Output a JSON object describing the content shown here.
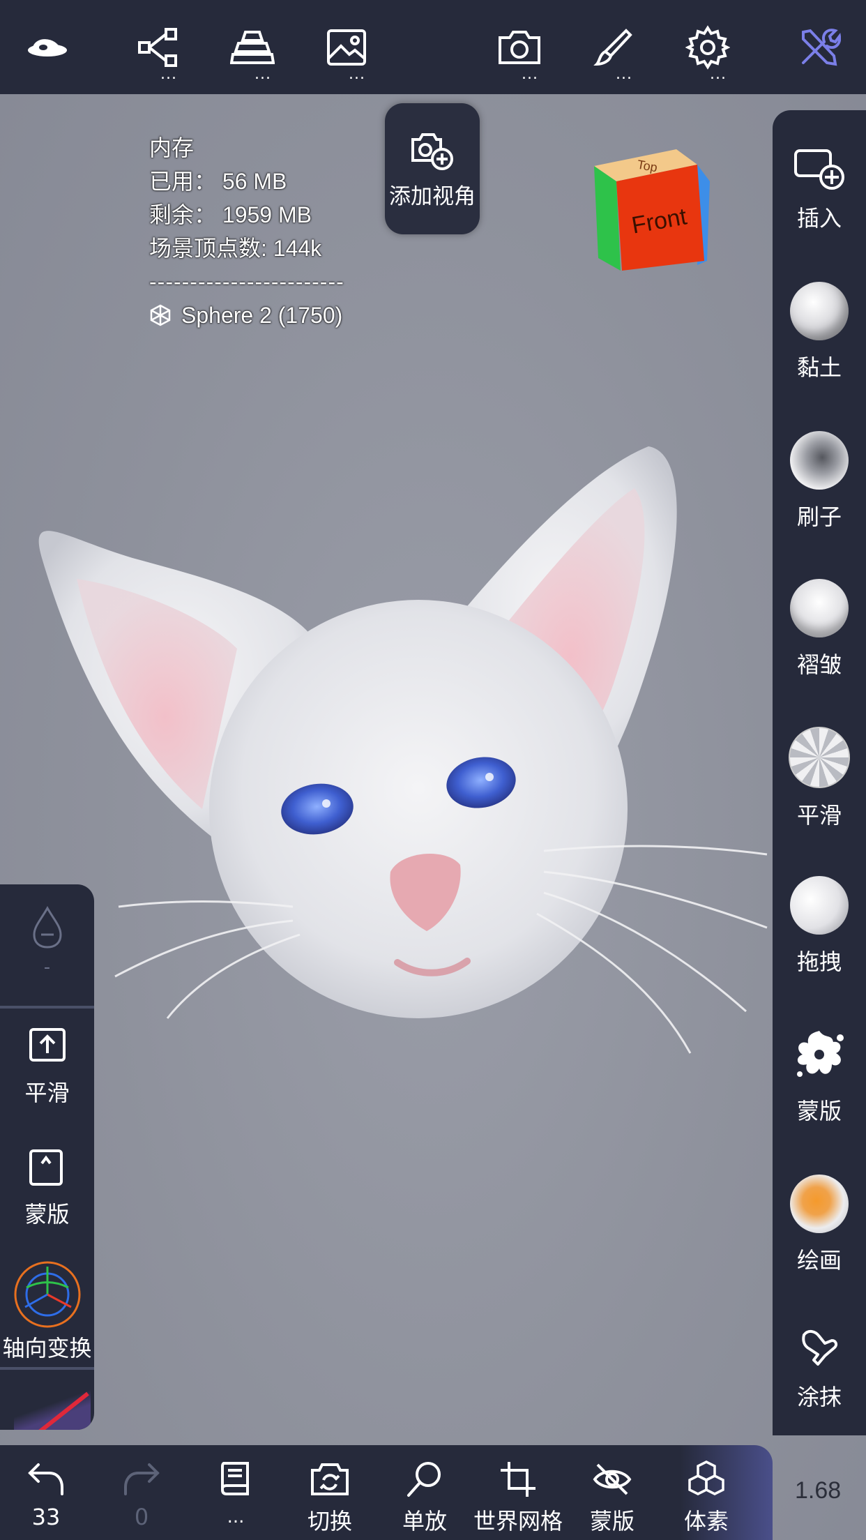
{
  "topbar": {
    "icons": [
      "sculpt-logo-icon",
      "scene-graph-icon",
      "material-stack-icon",
      "background-image-icon",
      "camera-icon",
      "brush-settings-icon",
      "settings-gear-icon",
      "tools-icon"
    ],
    "more_indicator": "..."
  },
  "info": {
    "memory_title": "内存",
    "used": "已用：  56 MB",
    "free": "剩余：  1959 MB",
    "vertices": "场景顶点数: 144k",
    "separator": "------------------------",
    "object": "Sphere 2 (1750)"
  },
  "add_view": {
    "label": "添加视角"
  },
  "view_cube": {
    "front": "Front",
    "top": "Top"
  },
  "right_tools": [
    {
      "label": "插入"
    },
    {
      "label": "黏土"
    },
    {
      "label": "刷子"
    },
    {
      "label": "褶皱"
    },
    {
      "label": "平滑"
    },
    {
      "label": "拖拽"
    },
    {
      "label": "蒙版"
    },
    {
      "label": "绘画"
    },
    {
      "label": "涂抹"
    }
  ],
  "left_tools": {
    "drop_value": "-",
    "smooth": "平滑",
    "mask": "蒙版",
    "axis_transform": "轴向变换"
  },
  "bottom": {
    "undo_count": "33",
    "redo_count": "0",
    "history_more": "...",
    "switch": "切换",
    "solo": "单放",
    "world_grid": "世界网格",
    "mask": "蒙版",
    "voxel": "体素"
  },
  "zoom_value": "1.68",
  "colors": {
    "panel": "#262a3b",
    "accent": "#7b7fe8",
    "cube_front": "#e8360f"
  }
}
